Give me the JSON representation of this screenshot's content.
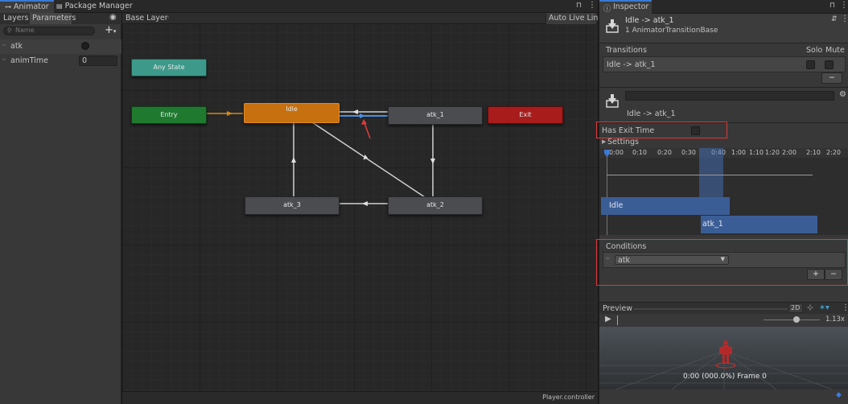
{
  "topbar": {
    "tabs": [
      {
        "label": "Animator",
        "icon": "animator-icon"
      },
      {
        "label": "Package Manager",
        "icon": "package-icon"
      }
    ],
    "lock_icon": "lock-icon",
    "menu_icon": "kebab-menu-icon"
  },
  "left_panel": {
    "tabs": [
      "Layers",
      "Parameters"
    ],
    "search_placeholder": "Name",
    "add_label": "+",
    "parameters": [
      {
        "name": "atk",
        "type": "trigger"
      },
      {
        "name": "animTime",
        "type": "float",
        "value": "0"
      }
    ]
  },
  "graph": {
    "breadcrumb": "Base Layer",
    "auto_live_link": "Auto Live Link",
    "footer": "Player.controller",
    "states": [
      {
        "id": "any",
        "label": "Any State",
        "color": "#3d9a8b"
      },
      {
        "id": "entry",
        "label": "Entry",
        "color": "#1f7a30"
      },
      {
        "id": "idle",
        "label": "Idle",
        "color": "#c6700f"
      },
      {
        "id": "atk_1",
        "label": "atk_1",
        "color": "#4a4c50"
      },
      {
        "id": "exit",
        "label": "Exit",
        "color": "#a81c1c"
      },
      {
        "id": "atk_3",
        "label": "atk_3",
        "color": "#4a4c50"
      },
      {
        "id": "atk_2",
        "label": "atk_2",
        "color": "#4a4c50"
      }
    ]
  },
  "inspector": {
    "tab_label": "Inspector",
    "header_title": "Idle -> atk_1",
    "header_subtitle": "1 AnimatorTransitionBase",
    "transitions_label": "Transitions",
    "solo_label": "Solo",
    "mute_label": "Mute",
    "transition_item": "Idle -> atk_1",
    "minus_label": "−",
    "name_field_value": "",
    "transition_name": "Idle -> atk_1",
    "has_exit_time_label": "Has Exit Time",
    "settings_label": "Settings",
    "timeline_ticks": [
      "0:00",
      "0:10",
      "0:20",
      "0:30",
      "0:40",
      "1:00",
      "1:10",
      "1:20",
      "2:00",
      "2:10",
      "2:20"
    ],
    "timeline_track_a": "Idle",
    "timeline_track_b": "atk_1",
    "conditions_label": "Conditions",
    "condition_param": "atk",
    "plus_label": "+",
    "preview_label": "Preview",
    "preview_2d": "2D",
    "speed": "1.13x",
    "frame_readout": "0:00 (000.0%) Frame 0"
  }
}
